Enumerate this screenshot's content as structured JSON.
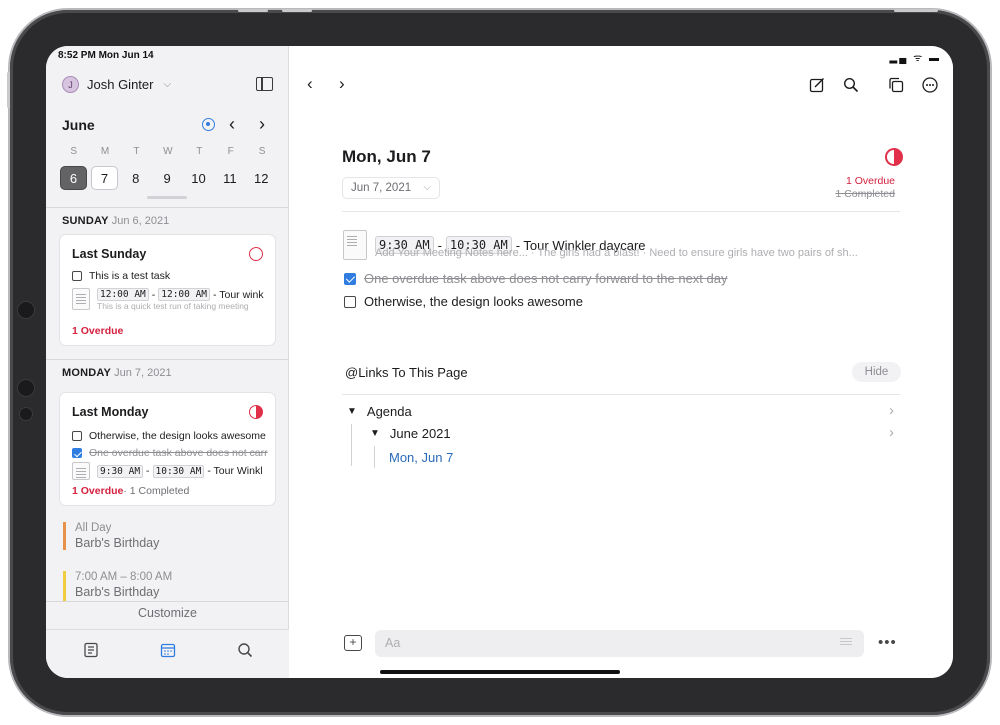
{
  "status_bar": {
    "time": "8:52 PM  Mon Jun 14",
    "icons": "▂▄ ᯤ ▬"
  },
  "sidebar": {
    "user": {
      "initial": "J",
      "name": "Josh Ginter"
    },
    "calendar": {
      "month": "June",
      "weekdays": [
        "S",
        "M",
        "T",
        "W",
        "T",
        "F",
        "S"
      ],
      "days": [
        "6",
        "7",
        "8",
        "9",
        "10",
        "11",
        "12"
      ],
      "selected_day": "6",
      "today_day": "7"
    },
    "sections": [
      {
        "weekday": "SUNDAY",
        "date": "Jun 6, 2021",
        "card": {
          "title": "Last Sunday",
          "task": "This is a test task",
          "meeting_start": "12:00 AM",
          "meeting_end": "12:00 AM",
          "meeting_title": "- Tour wink",
          "meeting_notes": "This is a quick test run of taking meeting",
          "summary_overdue": "1 Overdue"
        }
      },
      {
        "weekday": "MONDAY",
        "date": "Jun 7, 2021",
        "card": {
          "title": "Last Monday",
          "task_open": "Otherwise, the design looks awesome",
          "task_done": "One overdue task above does not carr",
          "meeting_start": "9:30 AM",
          "meeting_end": "10:30 AM",
          "meeting_title": "- Tour Winkl",
          "summary_overdue": "1 Overdue",
          "summary_completed": " · 1 Completed"
        }
      }
    ],
    "events": [
      {
        "time": "All Day",
        "title": "Barb's Birthday",
        "color": "#e8914a"
      },
      {
        "time": "7:00 AM – 8:00 AM",
        "title": "Barb's Birthday",
        "color": "#f0cd3f"
      }
    ],
    "customize_label": "Customize",
    "tabs": [
      "notes-tab",
      "calendar-tab",
      "search-tab"
    ]
  },
  "main": {
    "title": "Mon, Jun 7",
    "date_pill": "Jun 7, 2021",
    "summary_overdue": "1 Overdue",
    "summary_completed": "1 Completed",
    "meeting": {
      "start": "9:30 AM",
      "end": "10:30 AM",
      "dash": "-",
      "title": "- Tour Winkler daycare",
      "notes": "Add Your Meeting Notes here... · The girls had a blast! · Need to ensure girls have two pairs of sh..."
    },
    "task_done": "One overdue task above does not carry forward to the next day",
    "task_open": "Otherwise, the design looks awesome",
    "links": {
      "title": "@Links To This Page",
      "hide_label": "Hide",
      "tree": [
        {
          "label": "Agenda"
        },
        {
          "label": "June 2021"
        }
      ],
      "link": "Mon, Jun 7"
    },
    "composer_placeholder": "Aa",
    "accent_color": "#e0304a",
    "link_color": "#2a6bb8"
  }
}
